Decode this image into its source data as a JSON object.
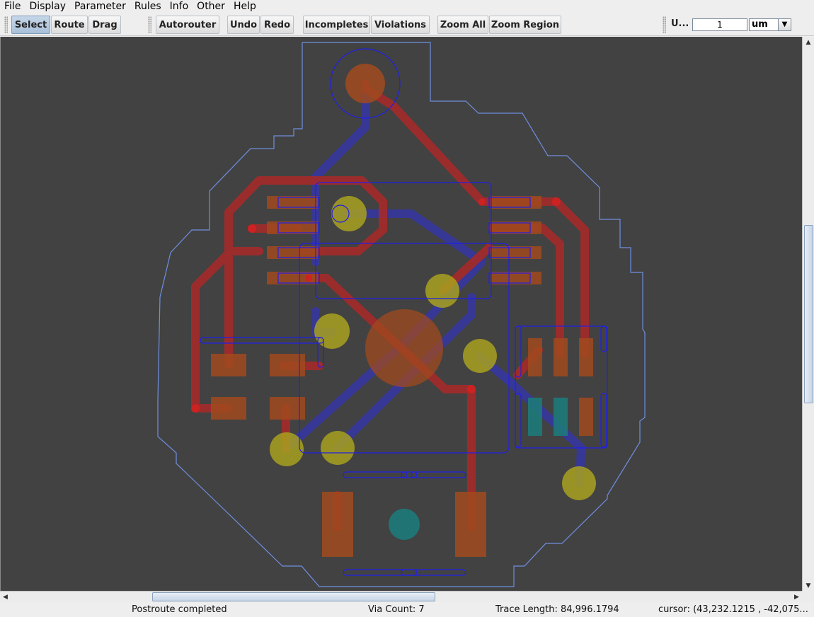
{
  "menu": [
    "File",
    "Display",
    "Parameter",
    "Rules",
    "Info",
    "Other",
    "Help"
  ],
  "toolbar": {
    "select_label": "Select",
    "route_label": "Route",
    "drag_label": "Drag",
    "autorouter_label": "Autorouter",
    "undo_label": "Undo",
    "redo_label": "Redo",
    "incompletes_label": "Incompletes",
    "violations_label": "Violations",
    "zoom_all_label": "Zoom All",
    "zoom_region_label": "Zoom Region",
    "unit_label": "U...",
    "unit_value": "1",
    "unit_select": "um"
  },
  "status": {
    "message": "Postroute completed",
    "via_count": "Via Count: 7",
    "trace_length": "Trace Length: 84,996.1794",
    "cursor": "cursor: (43,232.1215 , -42,075..."
  },
  "colors": {
    "canvas_bg": "#424242",
    "board_outline": "#6f8fe0",
    "top_trace": "#b02a2a",
    "bottom_trace": "#3a3aa8",
    "pad": "#a04a1e",
    "via": "#a8a020",
    "outline_blue": "#2222ee",
    "teal": "#1e7a7a"
  }
}
